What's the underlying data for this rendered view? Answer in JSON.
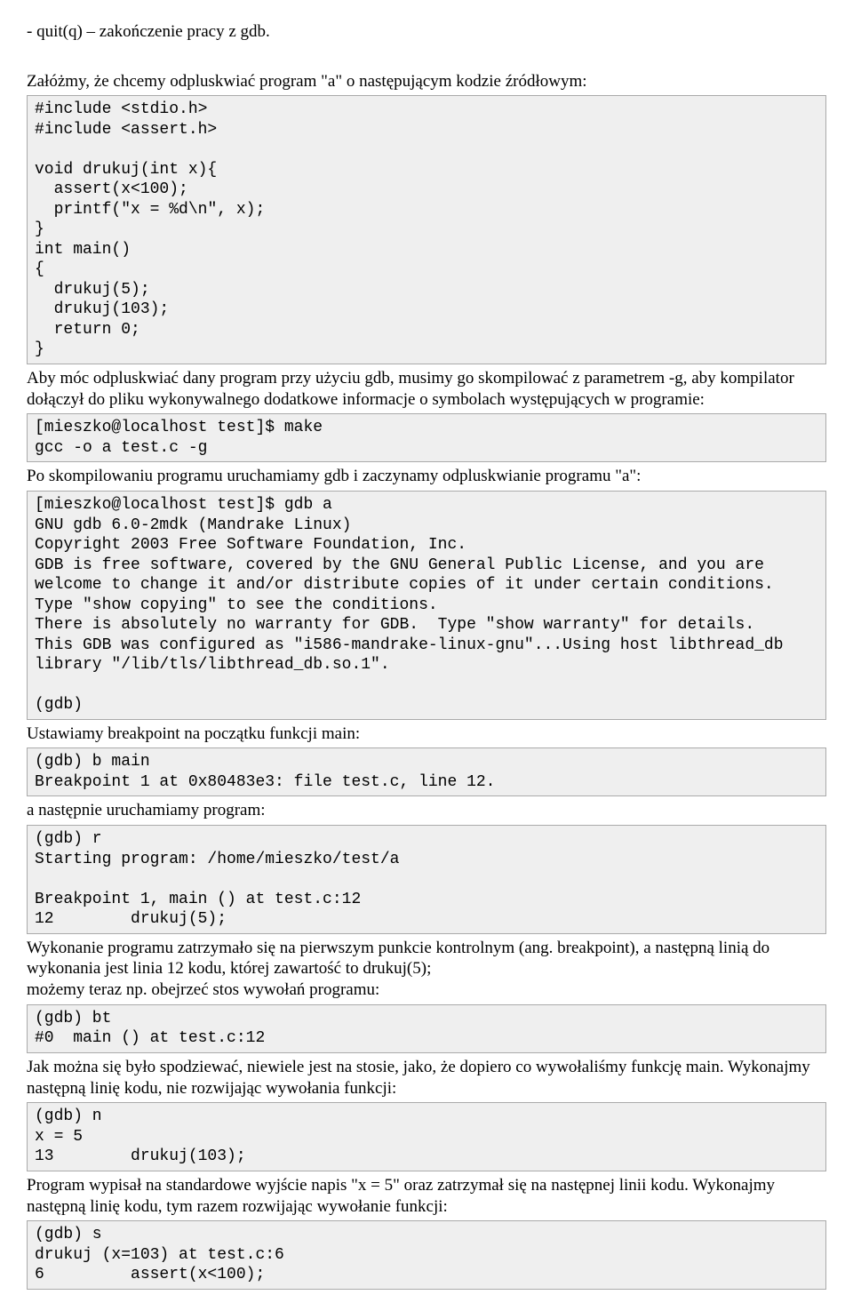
{
  "para1": "- quit(q) – zakończenie pracy z gdb.",
  "para2": "Załóżmy, że chcemy odpluskwiać program \"a\" o następującym kodzie źródłowym:",
  "code1": "#include <stdio.h>\n#include <assert.h>\n\nvoid drukuj(int x){\n  assert(x<100);\n  printf(\"x = %d\\n\", x);\n}\nint main()\n{\n  drukuj(5);\n  drukuj(103);\n  return 0;\n}",
  "para3": "Aby móc odpluskwiać dany program przy użyciu gdb, musimy go skompilować z parametrem -g, aby kompilator dołączył do pliku wykonywalnego dodatkowe informacje o symbolach występujących w programie:",
  "code2": "[mieszko@localhost test]$ make\ngcc -o a test.c -g",
  "para4": "Po skompilowaniu programu uruchamiamy gdb i zaczynamy odpluskwianie programu \"a\":",
  "code3": "[mieszko@localhost test]$ gdb a\nGNU gdb 6.0-2mdk (Mandrake Linux)\nCopyright 2003 Free Software Foundation, Inc.\nGDB is free software, covered by the GNU General Public License, and you are welcome to change it and/or distribute copies of it under certain conditions.\nType \"show copying\" to see the conditions.\nThere is absolutely no warranty for GDB.  Type \"show warranty\" for details.\nThis GDB was configured as \"i586-mandrake-linux-gnu\"...Using host libthread_db library \"/lib/tls/libthread_db.so.1\".\n\n(gdb)",
  "para5": "Ustawiamy breakpoint na początku funkcji main:",
  "code4": "(gdb) b main\nBreakpoint 1 at 0x80483e3: file test.c, line 12.",
  "para6": "a następnie uruchamiamy program:",
  "code5": "(gdb) r\nStarting program: /home/mieszko/test/a\n\nBreakpoint 1, main () at test.c:12\n12        drukuj(5);",
  "para7": "Wykonanie programu zatrzymało się na pierwszym punkcie kontrolnym (ang. breakpoint), a następną linią do wykonania jest linia 12 kodu, której zawartość to drukuj(5);\nmożemy teraz np. obejrzeć stos wywołań programu:",
  "code6": "(gdb) bt\n#0  main () at test.c:12",
  "para8": "Jak można się było spodziewać, niewiele jest na stosie, jako, że dopiero co wywołaliśmy funkcję main. Wykonajmy następną linię kodu, nie rozwijając wywołania funkcji:",
  "code7": "(gdb) n\nx = 5\n13        drukuj(103);",
  "para9": "Program wypisał na standardowe wyjście napis \"x = 5\" oraz zatrzymał się na następnej linii kodu. Wykonajmy następną linię kodu, tym razem rozwijając wywołanie funkcji:",
  "code8": "(gdb) s\ndrukuj (x=103) at test.c:6\n6         assert(x<100);"
}
